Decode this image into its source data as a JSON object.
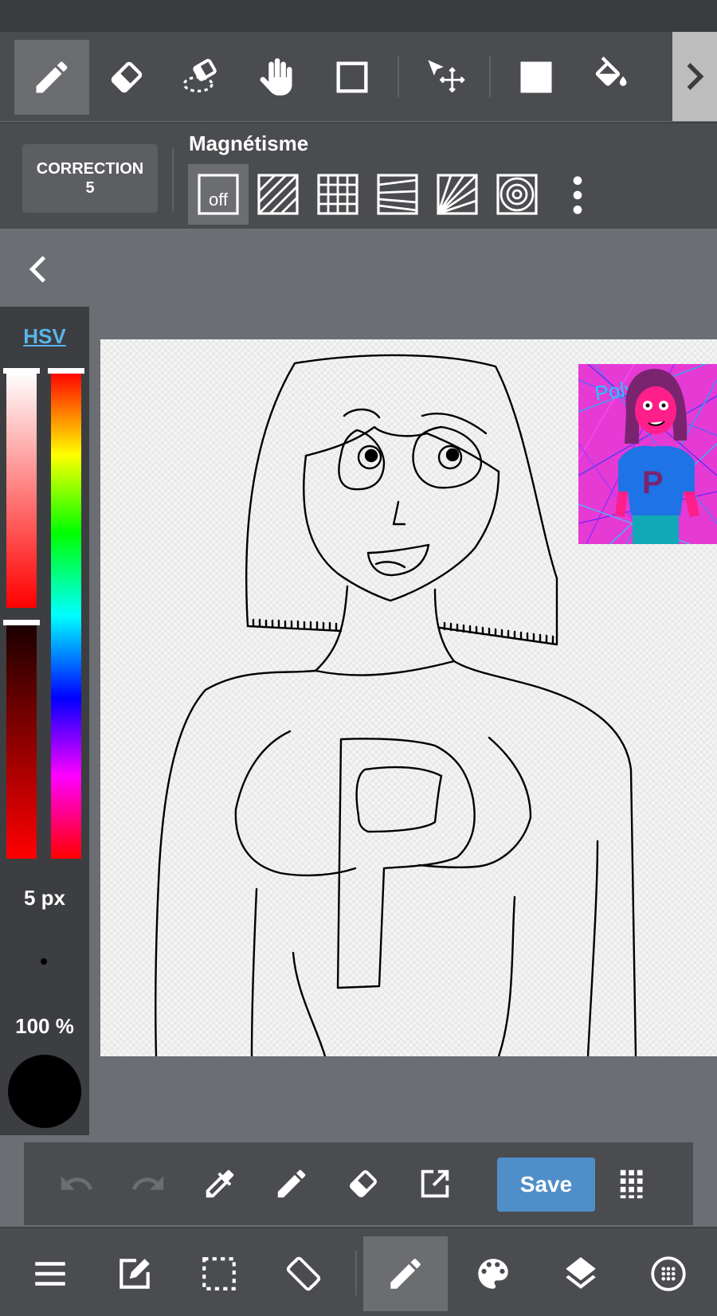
{
  "toolbar": {
    "tools": [
      {
        "icon": "pencil-icon",
        "active": true
      },
      {
        "icon": "eraser-icon",
        "active": false
      },
      {
        "icon": "blur-eraser-icon",
        "active": false
      },
      {
        "icon": "hand-icon",
        "active": false
      },
      {
        "icon": "rectangle-icon",
        "active": false
      },
      {
        "icon": "move-icon",
        "active": false
      },
      {
        "icon": "fill-rectangle-icon",
        "active": false
      },
      {
        "icon": "bucket-icon",
        "active": false
      }
    ]
  },
  "options": {
    "correction_label": "CORRECTION",
    "correction_value": "5",
    "magnet_title": "Magnétisme",
    "snap_off_label": "off",
    "snaps": [
      "off",
      "parallel",
      "grid",
      "perspective",
      "radial",
      "circle"
    ]
  },
  "color_panel": {
    "mode_label": "HSV",
    "brush_size": "5 px",
    "opacity": "100 %",
    "current_color": "#000000"
  },
  "action_bar": {
    "save_label": "Save",
    "buttons": [
      "undo",
      "redo",
      "eyedropper",
      "pencil",
      "eraser",
      "export",
      "save",
      "grid-menu"
    ]
  },
  "nav_bar": {
    "buttons": [
      "menu",
      "edit",
      "selection",
      "rotate",
      "brush",
      "palette",
      "layers",
      "materials"
    ],
    "active": "brush"
  },
  "colors": {
    "accent": "#5ab4ea",
    "save_button": "#4f8ec8",
    "panel": "#4b4c4f",
    "background": "#6b6e72"
  }
}
